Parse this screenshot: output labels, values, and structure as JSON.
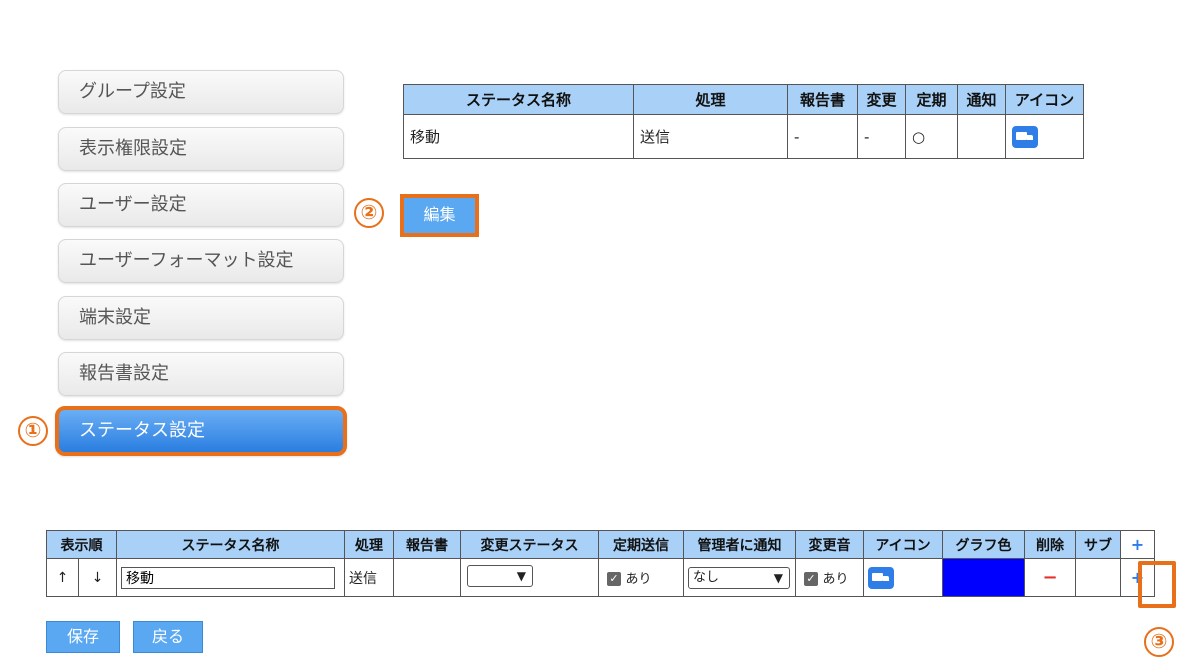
{
  "sidebar": {
    "items": [
      {
        "label": "グループ設定"
      },
      {
        "label": "表示権限設定"
      },
      {
        "label": "ユーザー設定"
      },
      {
        "label": "ユーザーフォーマット設定"
      },
      {
        "label": "端末設定"
      },
      {
        "label": "報告書設定"
      },
      {
        "label": "ステータス設定",
        "active": true
      }
    ]
  },
  "annotations": {
    "step1": "①",
    "step2": "②",
    "step3": "③"
  },
  "status_table": {
    "headers": [
      "ステータス名称",
      "処理",
      "報告書",
      "変更",
      "定期",
      "通知",
      "アイコン"
    ],
    "row": {
      "name": "移動",
      "process": "送信",
      "report": "-",
      "change": "-",
      "periodic": "○",
      "notify": "",
      "icon": "truck-icon"
    }
  },
  "edit_button": {
    "label": "編集"
  },
  "edit_table": {
    "headers": [
      "表示順",
      "ステータス名称",
      "処理",
      "報告書",
      "変更ステータス",
      "定期送信",
      "管理者に通知",
      "変更音",
      "アイコン",
      "グラフ色",
      "削除",
      "サブ",
      "+"
    ],
    "row": {
      "up": "↑",
      "down": "↓",
      "name_value": "移動",
      "process": "送信",
      "report": "",
      "change_status_value": "",
      "periodic_label": "あり",
      "notify_value": "なし",
      "sound_label": "あり",
      "icon": "truck-icon",
      "graph_color": "#0000ff",
      "delete": "−",
      "sub": "",
      "add": "+"
    }
  },
  "actions": {
    "save_label": "保存",
    "back_label": "戻る"
  },
  "colors": {
    "accent_orange": "#e8701a",
    "header_blue": "#a9d1f7",
    "button_blue": "#5ba8f2"
  }
}
